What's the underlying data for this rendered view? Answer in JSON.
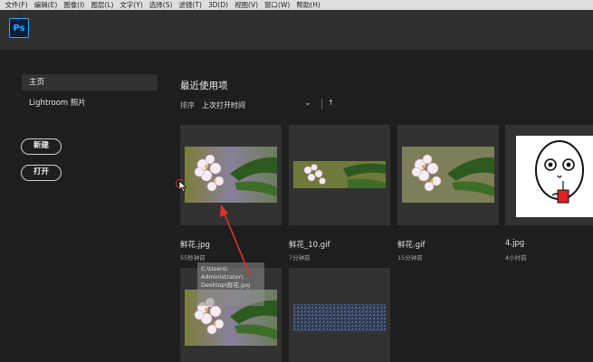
{
  "menu": [
    "文件(F)",
    "编辑(E)",
    "图像(I)",
    "图层(L)",
    "文字(Y)",
    "选择(S)",
    "滤镜(T)",
    "3D(D)",
    "视图(V)",
    "窗口(W)",
    "帮助(H)"
  ],
  "logo": "Ps",
  "sidebar": {
    "items": [
      {
        "label": "主页",
        "active": true
      },
      {
        "label": "Lightroom 照片",
        "active": false
      }
    ],
    "new_button": "新建",
    "open_button": "打开"
  },
  "recent": {
    "title": "最近使用项",
    "sort_label": "排序",
    "sort_value": "上次打开时间",
    "sort_dir_icon": "arrow-up-icon"
  },
  "files": [
    {
      "name": "鲜花.jpg",
      "time": "55秒钟前",
      "thumb": "flower-large"
    },
    {
      "name": "鲜花_10.gif",
      "time": "7分钟前",
      "thumb": "flower-strip"
    },
    {
      "name": "鲜花.gif",
      "time": "15分钟前",
      "thumb": "flower-large"
    },
    {
      "name": "4.jpg",
      "time": "4小时前",
      "thumb": "cartoon-face"
    },
    {
      "name": "",
      "time": "",
      "thumb": "flower-large"
    },
    {
      "name": "",
      "time": "",
      "thumb": "noise-strip"
    }
  ],
  "tooltip": [
    "C:\\Users\\",
    "Administrator\\",
    "Desktop\\鲜花.jpg"
  ],
  "colors": {
    "accent": "#31a8ff",
    "annotation": "#e0342a"
  }
}
